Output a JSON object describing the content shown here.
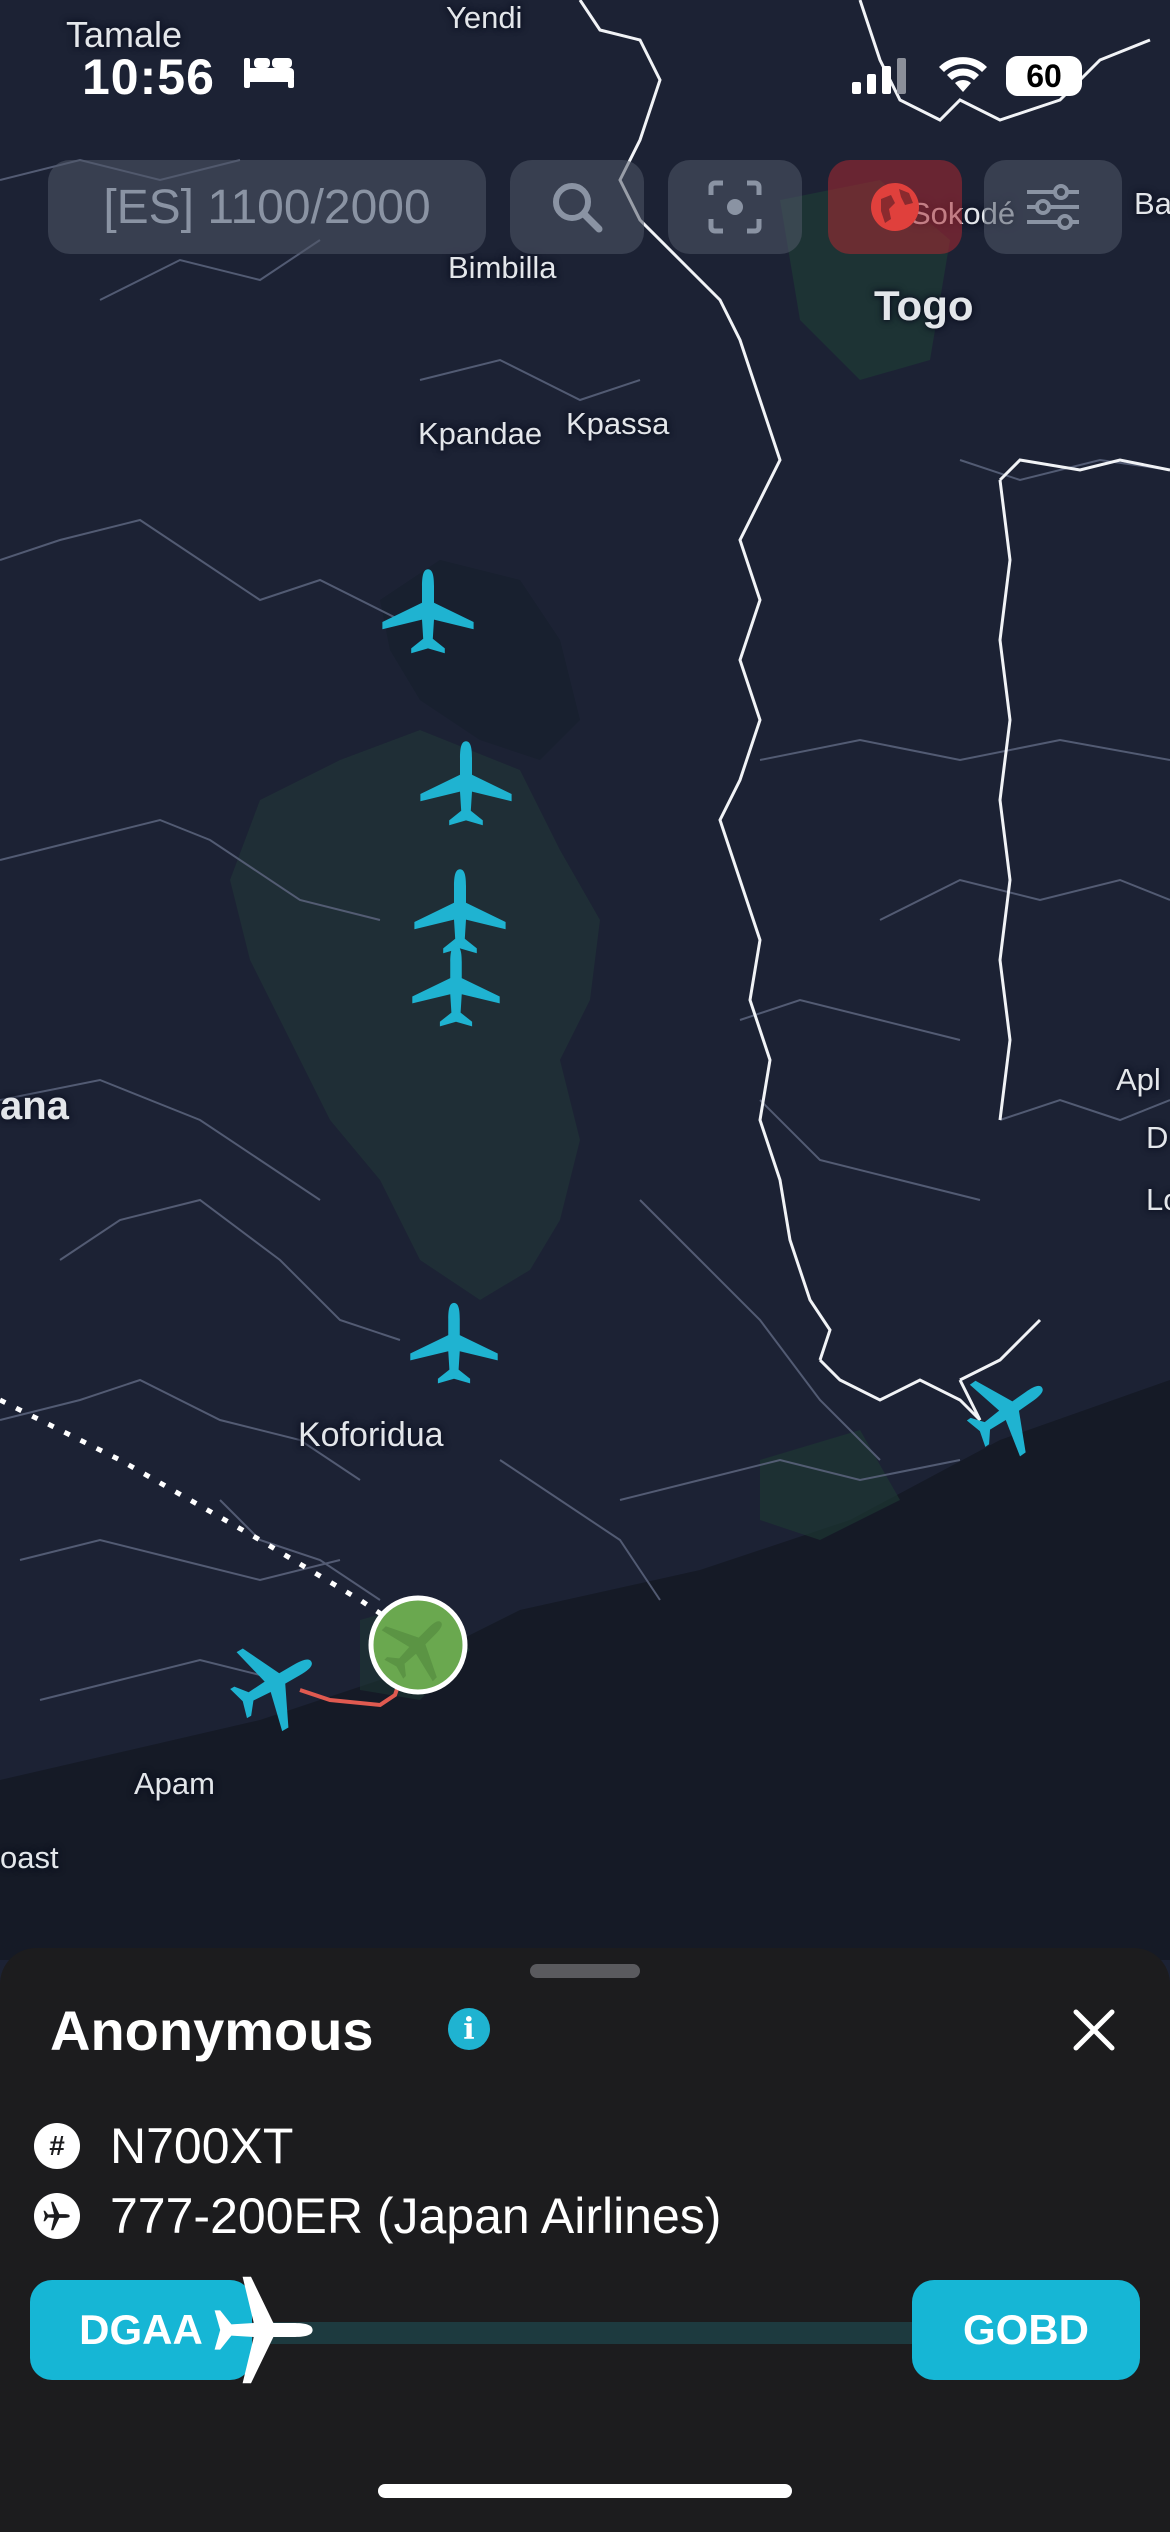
{
  "status": {
    "time": "10:56",
    "battery": "60"
  },
  "topbar": {
    "count_label": "[ES] 1100/2000"
  },
  "map": {
    "labels": {
      "tamale": "Tamale",
      "yendi": "Yendi",
      "bimbilla": "Bimbilla",
      "sokode": "Sokodé",
      "togo": "Togo",
      "kpandae": "Kpandae",
      "kpassa": "Kpassa",
      "ghana": "ana",
      "koforidua": "Koforidua",
      "apam": "Apam",
      "coast": "oast",
      "aplahoue": "Apl",
      "d": "D",
      "lo": "Lo",
      "ba": "Ba"
    },
    "aircraft_color": "#1fb3d1",
    "selected_color": "#6aa84f",
    "track_color": "#e05a50"
  },
  "sheet": {
    "title": "Anonymous",
    "registration": "N700XT",
    "aircraft_type": "777-200ER (Japan Airlines)",
    "origin": "DGAA",
    "destination": "GOBD",
    "progress": 0.03
  },
  "colors": {
    "accent": "#1fb3d1",
    "sheet_bg": "#1c1c1e",
    "map_bg": "#1c2234"
  }
}
